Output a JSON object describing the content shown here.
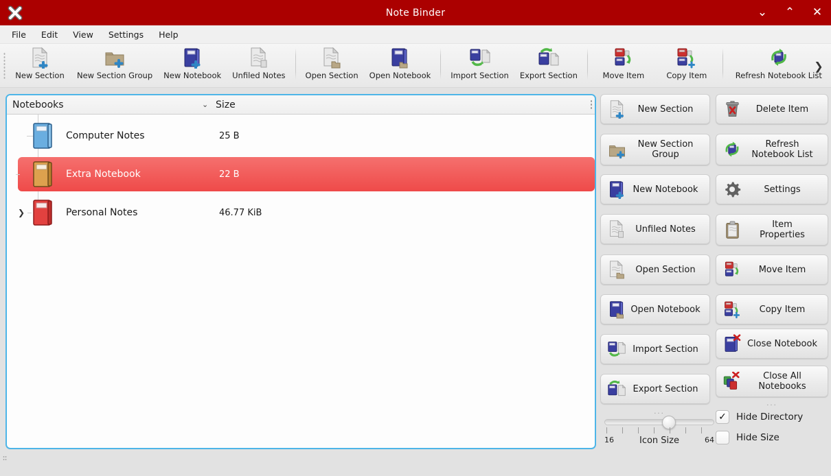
{
  "window": {
    "title": "Note Binder",
    "titlebar_color": "#ab0000",
    "close_left_icon": "close-icon",
    "minimize_label": "⌄",
    "maximize_label": "⌃",
    "close_label": "✕"
  },
  "menubar": {
    "items": [
      {
        "label": "File"
      },
      {
        "label": "Edit"
      },
      {
        "label": "View"
      },
      {
        "label": "Settings"
      },
      {
        "label": "Help"
      }
    ]
  },
  "toolbar": {
    "overflow_label": "❯",
    "groups": [
      {
        "items": [
          {
            "label": "New Section",
            "icon": "new-section-icon"
          },
          {
            "label": "New Section Group",
            "icon": "new-section-group-icon"
          },
          {
            "label": "New Notebook",
            "icon": "new-notebook-icon"
          },
          {
            "label": "Unfiled Notes",
            "icon": "unfiled-notes-icon"
          }
        ]
      },
      {
        "items": [
          {
            "label": "Open Section",
            "icon": "open-section-icon"
          },
          {
            "label": "Open Notebook",
            "icon": "open-notebook-icon"
          }
        ]
      },
      {
        "items": [
          {
            "label": "Import Section",
            "icon": "import-section-icon"
          },
          {
            "label": "Export Section",
            "icon": "export-section-icon"
          }
        ]
      },
      {
        "items": [
          {
            "label": "Move Item",
            "icon": "move-item-icon"
          },
          {
            "label": "Copy Item",
            "icon": "copy-item-icon"
          }
        ]
      },
      {
        "items": [
          {
            "label": "Refresh Notebook List",
            "icon": "refresh-notebook-list-icon"
          }
        ]
      }
    ]
  },
  "list": {
    "columns": {
      "name": "Notebooks",
      "size": "Size",
      "sort_indicator": "⌄"
    },
    "rows": [
      {
        "name": "Computer Notes",
        "size": "25 B",
        "icon": "notebook-icon-blue",
        "expandable": false,
        "selected": false
      },
      {
        "name": "Extra Notebook",
        "size": "22 B",
        "icon": "notebook-icon-orange",
        "expandable": false,
        "selected": true
      },
      {
        "name": "Personal Notes",
        "size": "46.77 KiB",
        "icon": "notebook-icon-red",
        "expandable": true,
        "expander": "❯",
        "selected": false
      }
    ]
  },
  "actions": {
    "left_column": [
      {
        "label": "New Section",
        "icon": "new-section-icon"
      },
      {
        "label": "New Section\nGroup",
        "icon": "new-section-group-icon"
      },
      {
        "label": "New Notebook",
        "icon": "new-notebook-icon"
      },
      {
        "label": "Unfiled Notes",
        "icon": "unfiled-notes-icon"
      },
      {
        "label": "Open Section",
        "icon": "open-section-icon"
      },
      {
        "label": "Open Notebook",
        "icon": "open-notebook-icon"
      },
      {
        "label": "Import Section",
        "icon": "import-section-icon"
      },
      {
        "label": "Export Section",
        "icon": "export-section-icon"
      }
    ],
    "right_column": [
      {
        "label": "Delete Item",
        "icon": "trash-icon"
      },
      {
        "label": "Refresh\nNotebook List",
        "icon": "refresh-notebook-list-icon"
      },
      {
        "label": "Settings",
        "icon": "gear-icon"
      },
      {
        "label": "Item\nProperties",
        "icon": "clipboard-icon"
      },
      {
        "label": "Move Item",
        "icon": "move-item-icon"
      },
      {
        "label": "Copy Item",
        "icon": "copy-item-icon"
      },
      {
        "label": "Close Notebook",
        "icon": "close-notebook-icon"
      },
      {
        "label": "Close All\nNotebooks",
        "icon": "close-all-notebooks-icon"
      }
    ]
  },
  "icon_size_slider": {
    "label": "Icon Size",
    "min": "16",
    "max": "64",
    "value_percent": 60,
    "dots": "···"
  },
  "options": {
    "dots": "···",
    "hide_directory": {
      "label": "Hide Directory",
      "checked": true,
      "check_glyph": "✓"
    },
    "hide_size": {
      "label": "Hide Size",
      "checked": false,
      "check_glyph": ""
    }
  }
}
